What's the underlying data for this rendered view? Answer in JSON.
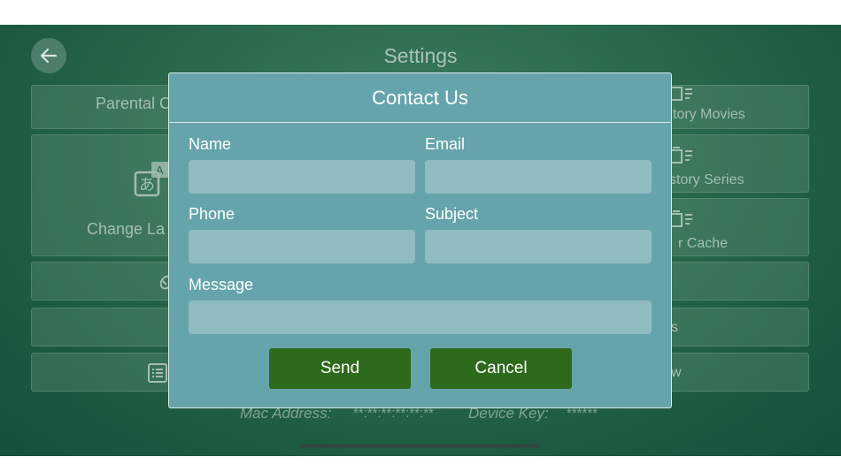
{
  "header": {
    "title": "Settings",
    "back_icon": "arrow-left-icon"
  },
  "background_tiles": {
    "parental": "Parental C",
    "change_language": "Change La",
    "history_movies": "tory Movies",
    "history_series": "story Series",
    "clear_cache": "r Cache",
    "row4_right": "s",
    "row5_right": "w"
  },
  "footer": {
    "mac_label": "Mac Address:",
    "mac_value": "**:**:**:**:**:**",
    "device_label": "Device Key:",
    "device_value": "******"
  },
  "modal": {
    "title": "Contact Us",
    "name_label": "Name",
    "name_value": "",
    "email_label": "Email",
    "email_value": "",
    "phone_label": "Phone",
    "phone_value": "",
    "subject_label": "Subject",
    "subject_value": "",
    "message_label": "Message",
    "message_value": "",
    "send_label": "Send",
    "cancel_label": "Cancel"
  },
  "colors": {
    "modal_bg": "#66a4ab",
    "input_bg": "#8fbcc0",
    "button_bg": "#2e6a1c",
    "background": "#2b6a4c"
  }
}
